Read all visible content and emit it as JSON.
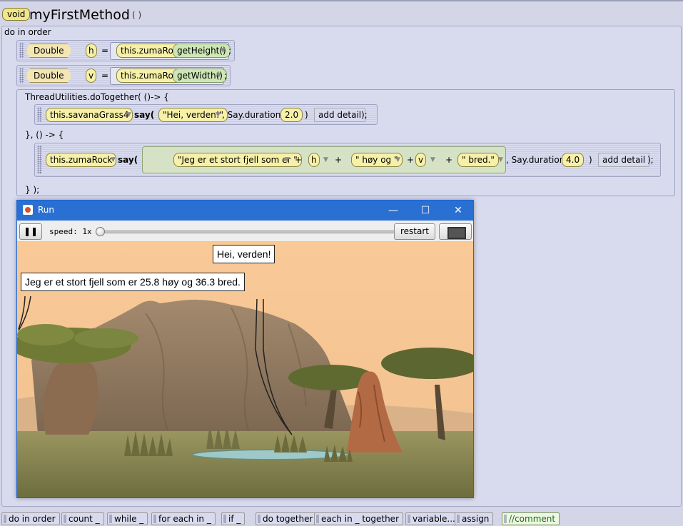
{
  "header": {
    "return_type": "void",
    "method_name": "myFirstMethod",
    "params": "( )"
  },
  "body_label": "do in order",
  "stmt_height": {
    "type": "Double",
    "var": "h",
    "eq": "=",
    "object": "this.zumaRock",
    "method": "getHeight()",
    "semi": ";"
  },
  "stmt_width": {
    "type": "Double",
    "var": "v",
    "eq": "=",
    "object": "this.zumaRock",
    "method": "getWidth()",
    "semi": ";"
  },
  "together": {
    "header": "ThreadUtilities.doTogether( ()-> {",
    "middle": "}, () -> {",
    "footer": "} );",
    "say1": {
      "object": "this.savanaGrass4",
      "method": "say(",
      "text": "\"Hei, verden!\"",
      "duration_label": ", Say.duration(",
      "duration": "2.0",
      "close": ")",
      "add_detail": "add detail",
      "end": ");"
    },
    "say2": {
      "object": "this.zumaRock",
      "method": "say(",
      "part1": "\"Jeg er et stort fjell som er \"",
      "plus": "+",
      "var_h": "h",
      "part2": "\" høy og \"",
      "var_v": "v",
      "part3": "\" bred.\"",
      "duration_label": ", Say.duration(",
      "duration": "4.0",
      "close": ")",
      "add_detail": "add detail",
      "end": ");"
    }
  },
  "run_window": {
    "title": "Run",
    "minimize": "—",
    "maximize": "☐",
    "close": "✕",
    "pause": "❚❚",
    "speed_label": "speed: 1x",
    "speed_value": 0.0,
    "restart": "restart",
    "bubble_grass": "Hei, verden!",
    "bubble_rock": "Jeg er et stort fjell som er 25.8 høy og 36.3 bred."
  },
  "palette": [
    "do in order",
    "count _",
    "while _",
    "for each in _",
    "if _",
    "do together",
    "each in _ together",
    "variable...",
    "assign",
    "//comment"
  ],
  "colors": {
    "titlebar": "#2a70d2",
    "sky": "#f7c994",
    "ground": "#8d8a57"
  }
}
